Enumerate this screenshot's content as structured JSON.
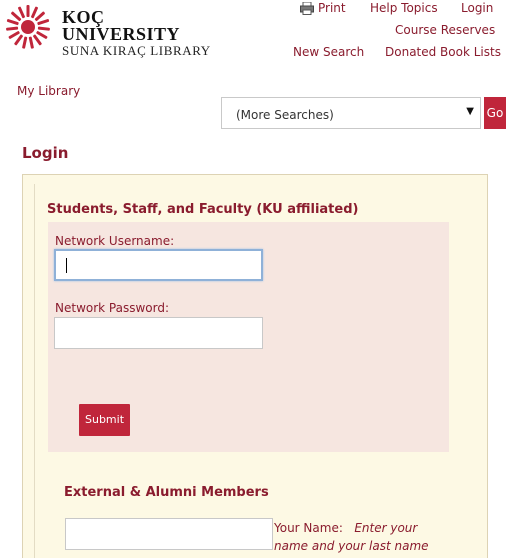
{
  "brand": {
    "line1": "KOÇ",
    "line2": "UNIVERSITY",
    "line3": "SUNA KIRAÇ LIBRARY",
    "color": "#c0263b"
  },
  "toplinks": {
    "print": "Print",
    "help": "Help Topics",
    "login": "Login",
    "course_reserves": "Course Reserves",
    "new_search": "New Search",
    "donated": "Donated Book Lists"
  },
  "nav": {
    "my_library": "My Library"
  },
  "search": {
    "selected": "(More Searches)",
    "go": "Go"
  },
  "page_title": "Login",
  "ku_section": {
    "title": "Students, Staff, and Faculty (KU affiliated)",
    "username_label": "Network Username:",
    "username_value": "",
    "password_label": "Network Password:",
    "password_value": "",
    "submit": "Submit"
  },
  "external_section": {
    "title": "External & Alumni Members",
    "name_label": "Your Name:",
    "name_hint": "Enter your name and your last name",
    "name_value": ""
  },
  "colors": {
    "accent": "#8a1c2e",
    "button": "#c0263b",
    "panel_bg": "#fdf9e4",
    "form_bg": "#f6e6e0"
  }
}
